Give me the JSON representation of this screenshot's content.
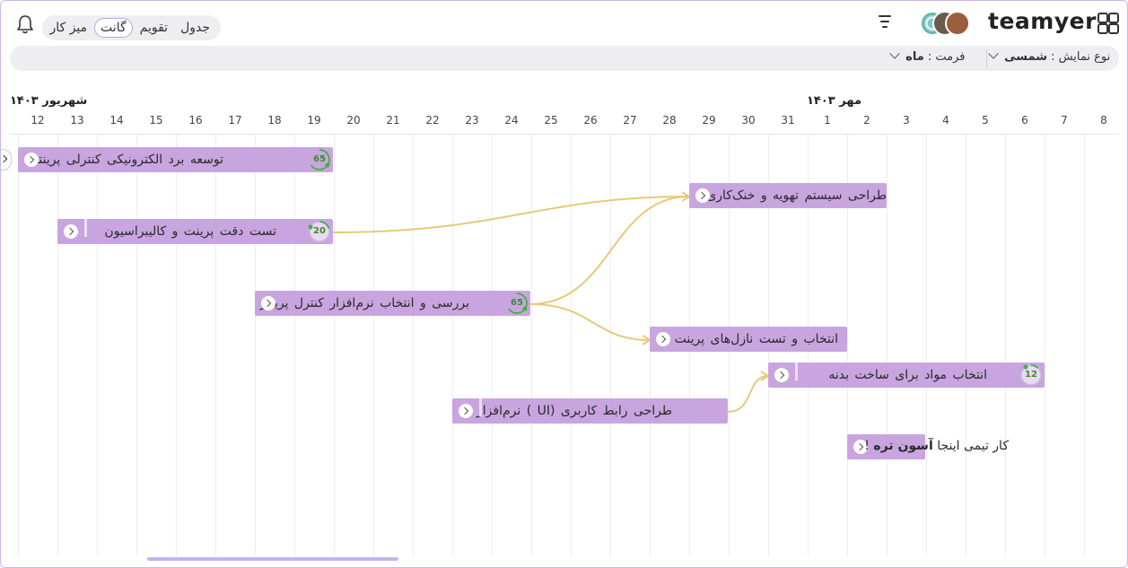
{
  "app": {
    "brand": "teamyer"
  },
  "header": {
    "views": [
      {
        "label": "جدول",
        "active": false
      },
      {
        "label": "تقویم",
        "active": false
      },
      {
        "label": "گانت",
        "active": true
      },
      {
        "label": "میز کار",
        "active": false
      }
    ],
    "icons": [
      "apps-grid-icon",
      "filter-lines-icon",
      "bell-icon",
      "team-logo-icon"
    ]
  },
  "filters": {
    "display_type_label": "نوع نمایش :",
    "display_type_value": "شمسی",
    "format_label": "فرمت :",
    "format_value": "ماه"
  },
  "timeline": {
    "months": [
      {
        "label": "شهریور ۱۴۰۳"
      },
      {
        "label": "مهر ۱۴۰۳"
      }
    ],
    "days": [
      "12",
      "13",
      "14",
      "15",
      "16",
      "17",
      "18",
      "19",
      "20",
      "21",
      "22",
      "23",
      "24",
      "25",
      "26",
      "27",
      "28",
      "29",
      "30",
      "31",
      "1",
      "2",
      "3",
      "4",
      "5",
      "6",
      "7",
      "8"
    ]
  },
  "tasks": [
    {
      "label": "توسعه برد الکترونیکی کنترلی پرینتر",
      "progress": 65
    },
    {
      "label": "تست  دقت  پرینت  و  کالیبراسیون",
      "progress": 20
    },
    {
      "label": "طراحی سیستم تهویه و خنک‌کاری"
    },
    {
      "label": "بررسی و انتخاب نرم‌افزار کنترل پرینتر",
      "progress": 65
    },
    {
      "label": "انتخاب و تست نازل‌های پرینت"
    },
    {
      "label": "انتخاب   مواد   برای   ساخت   بدنه",
      "progress": 12
    },
    {
      "label": "طراحی  رابط  کاربری  (UI )  نرم‌افزار"
    }
  ],
  "note": {
    "prefix": "کار تیمی اینجا ",
    "bold": "آسون تره",
    "suffix": " !"
  },
  "colors": {
    "bar": "#c9a5e0",
    "link": "#e8c97a",
    "progress": "#3db33d"
  }
}
